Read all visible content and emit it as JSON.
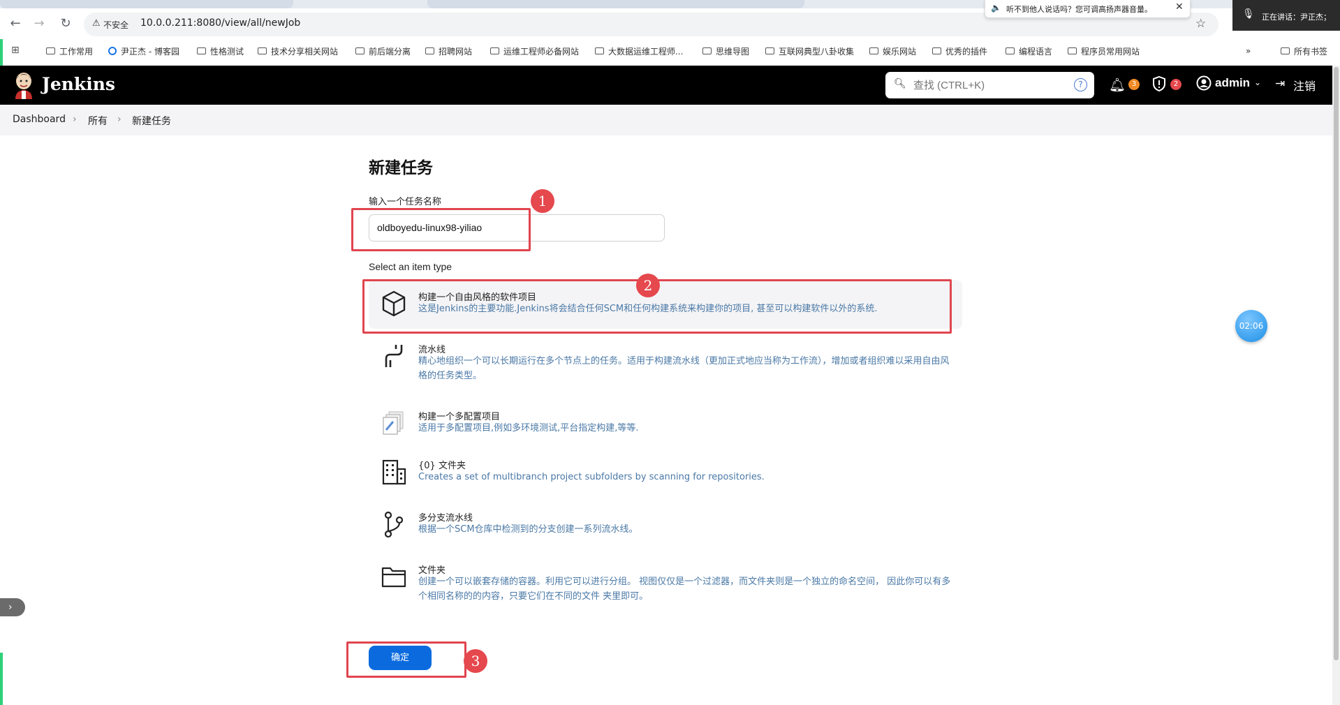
{
  "browser": {
    "tabs": [
      "",
      "",
      "",
      ""
    ],
    "address": {
      "security_label": "不安全",
      "url": "10.0.0.211:8080/view/all/newJob"
    },
    "notice": "听不到他人说话吗？您可调高扬声器音量。",
    "speaking": "正在讲话：尹正杰；",
    "bookmarks": [
      {
        "label": "工作常用",
        "icon": "folder-icon"
      },
      {
        "label": "尹正杰 - 博客园",
        "icon": "site-icon"
      },
      {
        "label": "性格测试",
        "icon": "folder-icon"
      },
      {
        "label": "技术分享相关网站",
        "icon": "folder-icon"
      },
      {
        "label": "前后端分离",
        "icon": "folder-icon"
      },
      {
        "label": "招聘网站",
        "icon": "folder-icon"
      },
      {
        "label": "运维工程师必备网站",
        "icon": "folder-icon"
      },
      {
        "label": "大数据运维工程师...",
        "icon": "folder-icon"
      },
      {
        "label": "思维导图",
        "icon": "folder-icon"
      },
      {
        "label": "互联网典型八卦收集",
        "icon": "folder-icon"
      },
      {
        "label": "娱乐网站",
        "icon": "folder-icon"
      },
      {
        "label": "优秀的插件",
        "icon": "folder-icon"
      },
      {
        "label": "编程语言",
        "icon": "folder-icon"
      },
      {
        "label": "程序员常用网站",
        "icon": "folder-icon"
      }
    ],
    "all_bookmarks": "所有书签",
    "overflow": "»"
  },
  "jenkins": {
    "logo_text": "Jenkins",
    "search_placeholder": "查找 (CTRL+K)",
    "notifications_count": "3",
    "security_count": "2",
    "user": "admin",
    "logout": "注销"
  },
  "breadcrumb": [
    "Dashboard",
    "所有",
    "新建任务"
  ],
  "page": {
    "title": "新建任务",
    "name_label": "输入一个任务名称",
    "name_value": "oldboyedu-linux98-yiliao",
    "type_label": "Select an item type",
    "items": [
      {
        "title": "构建一个自由风格的软件项目",
        "desc": "这是Jenkins的主要功能.Jenkins将会结合任何SCM和任何构建系统来构建你的项目, 甚至可以构建软件以外的系统.",
        "icon": "box-icon"
      },
      {
        "title": "流水线",
        "desc": "精心地组织一个可以长期运行在多个节点上的任务。适用于构建流水线（更加正式地应当称为工作流），增加或者组织难以采用自由风格的任务类型。",
        "icon": "pipeline-icon"
      },
      {
        "title": "构建一个多配置项目",
        "desc": "适用于多配置项目,例如多环境测试,平台指定构建,等等.",
        "icon": "multi-config-icon"
      },
      {
        "title": "{0} 文件夹",
        "desc": "Creates a set of multibranch project subfolders by scanning for repositories.",
        "icon": "organization-icon"
      },
      {
        "title": "多分支流水线",
        "desc": "根据一个SCM仓库中检测到的分支创建一系列流水线。",
        "icon": "branch-icon"
      },
      {
        "title": "文件夹",
        "desc": "创建一个可以嵌套存储的容器。利用它可以进行分组。 视图仅仅是一个过滤器，而文件夹则是一个独立的命名空间， 因此你可以有多个相同名称的的内容，只要它们在不同的文件 夹里即可。",
        "icon": "folder-icon"
      }
    ],
    "ok_button": "确定"
  },
  "annotations": [
    "1",
    "2",
    "3"
  ],
  "timer": "02:06",
  "colors": {
    "header": "#000000",
    "ok_button": "#0b6bde",
    "annotation_red": "#e5484d",
    "desc_blue": "#4a78a6"
  }
}
